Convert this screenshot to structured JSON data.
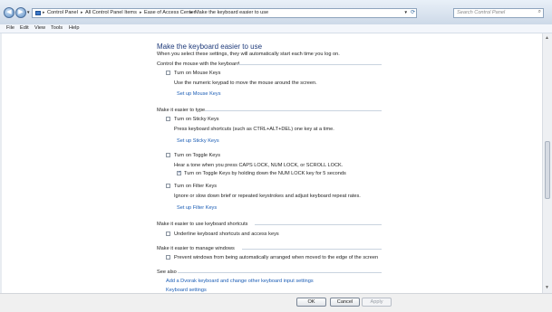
{
  "breadcrumb": {
    "items": [
      "Control Panel",
      "All Control Panel Items",
      "Ease of Access Center",
      "Make the keyboard easier to use"
    ]
  },
  "search": {
    "placeholder": "Search Control Panel"
  },
  "menu": {
    "items": [
      "File",
      "Edit",
      "View",
      "Tools",
      "Help"
    ]
  },
  "page": {
    "title": "Make the keyboard easier to use",
    "subtitle": "When you select these settings, they will automatically start each time you log on."
  },
  "sections": {
    "mouse": {
      "heading": "Control the mouse with the keyboard",
      "mouse_keys_label": "Turn on Mouse Keys",
      "mouse_keys_checked": false,
      "mouse_keys_desc": "Use the numeric keypad to move the mouse around the screen.",
      "mouse_keys_link": "Set up Mouse Keys"
    },
    "typing": {
      "heading": "Make it easier to type",
      "sticky_label": "Turn on Sticky Keys",
      "sticky_checked": false,
      "sticky_desc": "Press keyboard shortcuts (such as CTRL+ALT+DEL) one key at a time.",
      "sticky_link": "Set up Sticky Keys",
      "toggle_label": "Turn on Toggle Keys",
      "toggle_checked": false,
      "toggle_desc": "Hear a tone when you press CAPS LOCK, NUM LOCK, or SCROLL LOCK.",
      "toggle_hold_label": "Turn on Toggle Keys by holding down the NUM LOCK key for 5 seconds",
      "toggle_hold_checked": true,
      "filter_label": "Turn on Filter Keys",
      "filter_checked": false,
      "filter_desc": "Ignore or slow down brief or repeated keystrokes and adjust keyboard repeat rates.",
      "filter_link": "Set up Filter Keys"
    },
    "shortcuts": {
      "heading": "Make it easier to use keyboard shortcuts",
      "underline_label": "Underline keyboard shortcuts and access keys",
      "underline_checked": false
    },
    "windows": {
      "heading": "Make it easier to manage windows",
      "prevent_label": "Prevent windows from being automatically arranged when moved to the edge of the screen",
      "prevent_checked": false
    },
    "see_also": {
      "heading": "See also",
      "links": [
        "Add a Dvorak keyboard and change other keyboard input settings",
        "Keyboard settings"
      ]
    }
  },
  "buttons": {
    "ok": "OK",
    "cancel": "Cancel",
    "apply": "Apply",
    "apply_enabled": false
  },
  "colors": {
    "link": "#1b5db5",
    "title": "#1e3a7a",
    "accent": "#5f8fc4"
  }
}
